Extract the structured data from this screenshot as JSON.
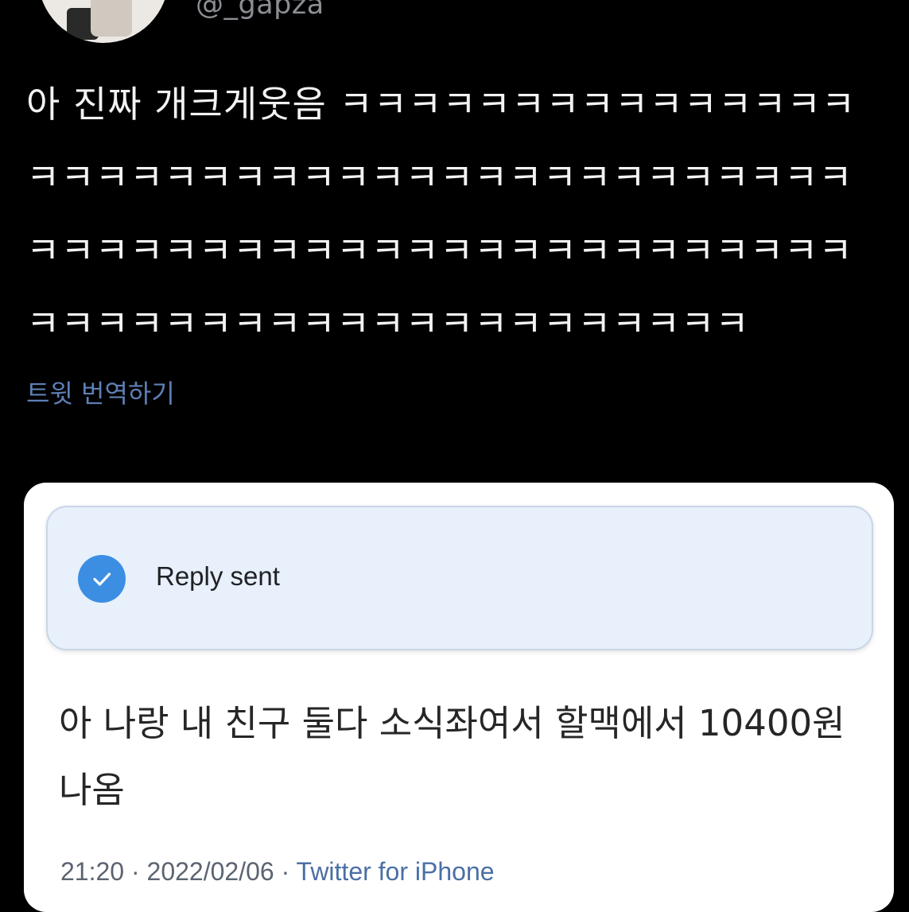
{
  "author": {
    "handle": "@_gapza"
  },
  "tweet": {
    "text": "아 진짜 개크게웃음 ㅋㅋㅋㅋㅋㅋㅋㅋㅋㅋㅋㅋㅋㅋㅋㅋㅋㅋㅋㅋㅋㅋㅋㅋㅋㅋㅋㅋㅋㅋㅋㅋㅋㅋㅋㅋㅋㅋㅋㅋㅋㅋㅋㅋㅋㅋㅋㅋㅋㅋㅋㅋㅋㅋㅋㅋㅋㅋㅋㅋㅋㅋㅋㅋㅋㅋㅋㅋㅋㅋㅋㅋㅋㅋㅋㅋㅋㅋㅋㅋㅋㅋㅋㅋ",
    "translate_label": "트윗 번역하기"
  },
  "toast": {
    "label": "Reply sent",
    "icon": "check-icon",
    "accent_color": "#3c8ee3"
  },
  "reply": {
    "text": "아 나랑 내 친구 둘다 소식좌여서 할맥에서 10400원 나옴",
    "time": "21:20",
    "separator": "·",
    "date": "2022/02/06",
    "source": "Twitter for iPhone"
  }
}
